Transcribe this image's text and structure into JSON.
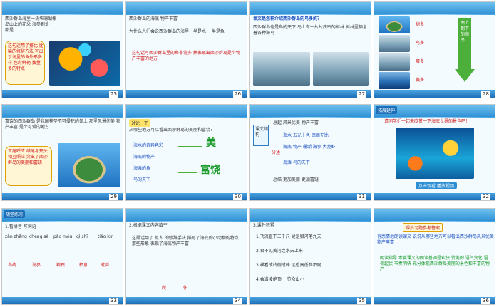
{
  "slides": [
    {
      "num": "25",
      "lines": [
        "西沙群岛海里一块块珊瑚像",
        "岛山上的花朵 海参到处",
        "都是 …"
      ],
      "note": "这句运用了排比 比喻的修辞方法 写出了海里的鱼外形多样 色彩鲜艳 数量多的特点"
    },
    {
      "num": "26",
      "lines": [
        "西沙群岛的海底 物产丰富",
        "为什么人们会说西沙群岛的海里一半是水 一半是鱼"
      ],
      "note": "这句话写西沙群岛里的鱼非常多 并表现出西沙群岛是个物产丰富的地方"
    },
    {
      "num": "27",
      "title": "课文是怎样介绍西沙群岛的鸟多的？",
      "lines": [
        "西沙群岛也是鸟的天下 岛上有一片片茂密的树林 树林里栖息着各种海鸟"
      ]
    },
    {
      "num": "28",
      "labels": [
        "树多",
        "鸟多",
        "蛋多",
        "粪多"
      ],
      "arrow": "由上到下的顺序"
    },
    {
      "num": "29",
      "lines": [
        "富饶的西沙群岛 是我国神圣不可侵犯的领土 那里风景优美 物产丰富 是个可爱的地方"
      ],
      "note": "首尾呼应 结尾与开头相互照应 突出了西沙群岛的美丽和富饶"
    },
    {
      "num": "30",
      "title": "讨论一下",
      "q": "从哪些地方可以看出西沙群岛的美丽和富饶？",
      "items": [
        "海水的奇异色彩",
        "海底的物产",
        "海滩的鱼",
        "鸟的天下"
      ],
      "big1": "美",
      "big2": "富饶"
    },
    {
      "num": "31",
      "rows": [
        "总起 风景优美 物产丰富",
        "海水 五光十色 瑰丽无比",
        "海底 物产 珊瑚 海参 大龙虾",
        "海滩 鸟的天下",
        "总结 更加美丽 更加富饶"
      ],
      "side": "分述",
      "tag": "课文结构"
    },
    {
      "num": "32",
      "title": "拓展延伸",
      "q": "请同学们一起来欣赏一下海底世界的景色吧！",
      "btn": "点击观看 播放视频"
    },
    {
      "num": "33",
      "title": "随堂练习",
      "q": "1.看拼音 写词语",
      "pinyin": [
        "zàn zhǎng",
        "chéng sè",
        "pào móu",
        "qì shī",
        "tiáo lún"
      ],
      "answers": [
        "岛屿",
        "海参",
        "岩石",
        "栖息",
        "成群"
      ]
    },
    {
      "num": "34",
      "q": "2.根据课文内容填空",
      "lines": [
        "这段话用了 拟人 的修辞手法 描写了海底的小动物的特点 那些形象 表现了海底物产丰富"
      ],
      "answers": [
        "爬",
        "伸"
      ]
    },
    {
      "num": "35",
      "q": "3.课外积累",
      "lines": [
        "1.飞流直下三千尺 疑是银河落九天",
        "2.君不见黄河之水天上来",
        "3.横看成岭侧成峰 远近高低各不同",
        "4.会当凌绝顶 一览众山小"
      ]
    },
    {
      "num": "36",
      "title": "课后习题参考答案",
      "lines": [
        "有感情地朗读课文 说说从哪些地方可以看出西沙群岛风景优美 物产丰富"
      ],
      "note": "朗读指导 本篇课文的朗读基调是欢快 赞美的 语气变化 语调起伏 节奏明快 充分体现西沙群岛美丽的景色和丰富的物产"
    }
  ]
}
